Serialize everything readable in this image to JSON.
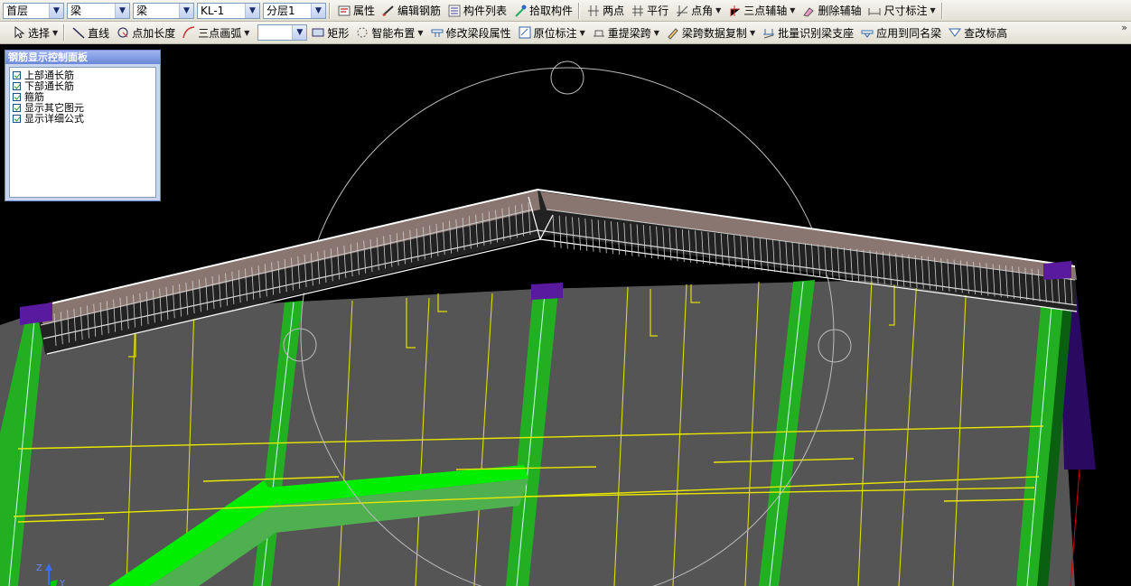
{
  "toolbar1": {
    "floor_select": "首层",
    "category_select": "梁",
    "type_select": "梁",
    "name_select": "KL-1",
    "layer_select": "分层1",
    "buttons": [
      "属性",
      "编辑钢筋",
      "构件列表",
      "拾取构件",
      "两点",
      "平行",
      "点角",
      "三点辅轴",
      "删除辅轴",
      "尺寸标注"
    ]
  },
  "toolbar2": {
    "select_label": "选择",
    "buttons": [
      "直线",
      "点加长度",
      "三点画弧",
      "矩形",
      "智能布置",
      "修改梁段属性",
      "原位标注",
      "重提梁跨",
      "梁跨数据复制",
      "批量识别梁支座",
      "应用到同名梁",
      "查改标高"
    ],
    "blank_select": ""
  },
  "panel": {
    "title": "钢筋显示控制面板",
    "items": [
      {
        "label": "上部通长筋",
        "checked": true
      },
      {
        "label": "下部通长筋",
        "checked": true
      },
      {
        "label": "箍筋",
        "checked": true
      },
      {
        "label": "显示其它图元",
        "checked": true
      },
      {
        "label": "显示详细公式",
        "checked": true
      }
    ]
  },
  "axis": {
    "z_label": "Z",
    "y_label": "Y"
  },
  "colors": {
    "green": "#22b022",
    "bright_green": "#00ff00",
    "purple": "#3d0a7a",
    "slab": "#555555",
    "yellow": "#e6e600"
  }
}
